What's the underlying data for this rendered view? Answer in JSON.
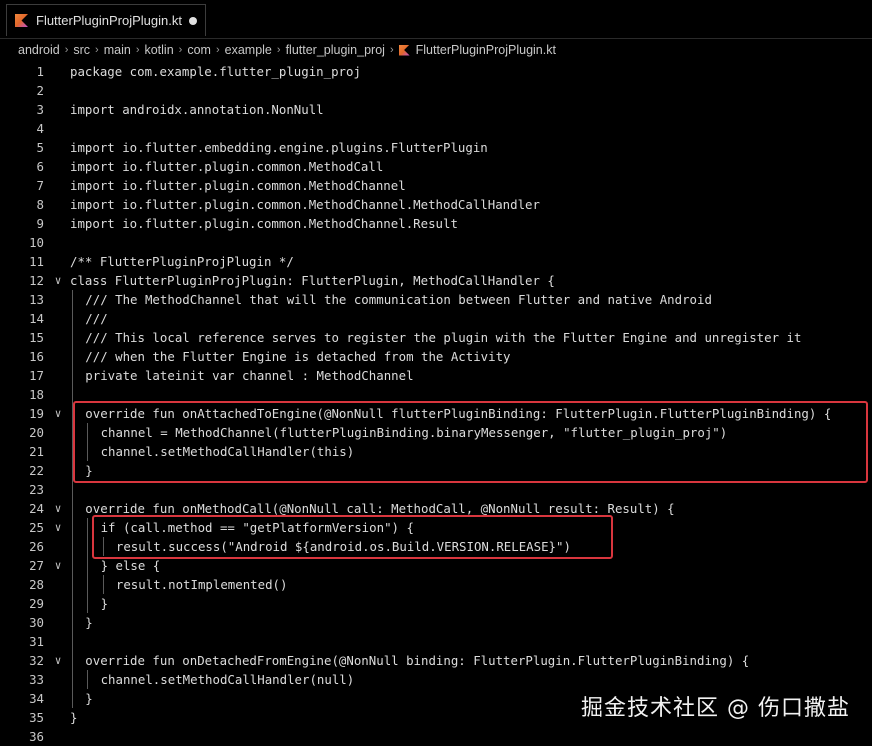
{
  "tab": {
    "filename": "FlutterPluginProjPlugin.kt"
  },
  "breadcrumb": [
    "android",
    "src",
    "main",
    "kotlin",
    "com",
    "example",
    "flutter_plugin_proj",
    "FlutterPluginProjPlugin.kt"
  ],
  "lines": [
    {
      "n": "1",
      "text": "package com.example.flutter_plugin_proj",
      "indent": 0
    },
    {
      "n": "2",
      "text": "",
      "indent": 0
    },
    {
      "n": "3",
      "text": "import androidx.annotation.NonNull",
      "indent": 0
    },
    {
      "n": "4",
      "text": "",
      "indent": 0
    },
    {
      "n": "5",
      "text": "import io.flutter.embedding.engine.plugins.FlutterPlugin",
      "indent": 0
    },
    {
      "n": "6",
      "text": "import io.flutter.plugin.common.MethodCall",
      "indent": 0
    },
    {
      "n": "7",
      "text": "import io.flutter.plugin.common.MethodChannel",
      "indent": 0
    },
    {
      "n": "8",
      "text": "import io.flutter.plugin.common.MethodChannel.MethodCallHandler",
      "indent": 0
    },
    {
      "n": "9",
      "text": "import io.flutter.plugin.common.MethodChannel.Result",
      "indent": 0
    },
    {
      "n": "10",
      "text": "",
      "indent": 0
    },
    {
      "n": "11",
      "text": "/** FlutterPluginProjPlugin */",
      "indent": 0
    },
    {
      "n": "12",
      "text": "class FlutterPluginProjPlugin: FlutterPlugin, MethodCallHandler {",
      "indent": 0,
      "fold": true
    },
    {
      "n": "13",
      "text": "/// The MethodChannel that will the communication between Flutter and native Android",
      "indent": 1
    },
    {
      "n": "14",
      "text": "///",
      "indent": 1
    },
    {
      "n": "15",
      "text": "/// This local reference serves to register the plugin with the Flutter Engine and unregister it",
      "indent": 1
    },
    {
      "n": "16",
      "text": "/// when the Flutter Engine is detached from the Activity",
      "indent": 1
    },
    {
      "n": "17",
      "text": "private lateinit var channel : MethodChannel",
      "indent": 1
    },
    {
      "n": "18",
      "text": "",
      "indent": 1
    },
    {
      "n": "19",
      "text": "override fun onAttachedToEngine(@NonNull flutterPluginBinding: FlutterPlugin.FlutterPluginBinding) {",
      "indent": 1,
      "fold": true
    },
    {
      "n": "20",
      "text": "channel = MethodChannel(flutterPluginBinding.binaryMessenger, \"flutter_plugin_proj\")",
      "indent": 2
    },
    {
      "n": "21",
      "text": "channel.setMethodCallHandler(this)",
      "indent": 2
    },
    {
      "n": "22",
      "text": "}",
      "indent": 1
    },
    {
      "n": "23",
      "text": "",
      "indent": 1
    },
    {
      "n": "24",
      "text": "override fun onMethodCall(@NonNull call: MethodCall, @NonNull result: Result) {",
      "indent": 1,
      "fold": true
    },
    {
      "n": "25",
      "text": "if (call.method == \"getPlatformVersion\") {",
      "indent": 2,
      "fold": true
    },
    {
      "n": "26",
      "text": "result.success(\"Android ${android.os.Build.VERSION.RELEASE}\")",
      "indent": 3
    },
    {
      "n": "27",
      "text": "} else {",
      "indent": 2,
      "fold": true
    },
    {
      "n": "28",
      "text": "result.notImplemented()",
      "indent": 3
    },
    {
      "n": "29",
      "text": "}",
      "indent": 2
    },
    {
      "n": "30",
      "text": "}",
      "indent": 1
    },
    {
      "n": "31",
      "text": "",
      "indent": 1
    },
    {
      "n": "32",
      "text": "override fun onDetachedFromEngine(@NonNull binding: FlutterPlugin.FlutterPluginBinding) {",
      "indent": 1,
      "fold": true
    },
    {
      "n": "33",
      "text": "channel.setMethodCallHandler(null)",
      "indent": 2
    },
    {
      "n": "34",
      "text": "}",
      "indent": 1
    },
    {
      "n": "35",
      "text": "}",
      "indent": 0
    },
    {
      "n": "36",
      "text": "",
      "indent": 0
    }
  ],
  "highlight_color": "#d9363e",
  "watermark": "掘金技术社区 @ 伤口撒盐"
}
